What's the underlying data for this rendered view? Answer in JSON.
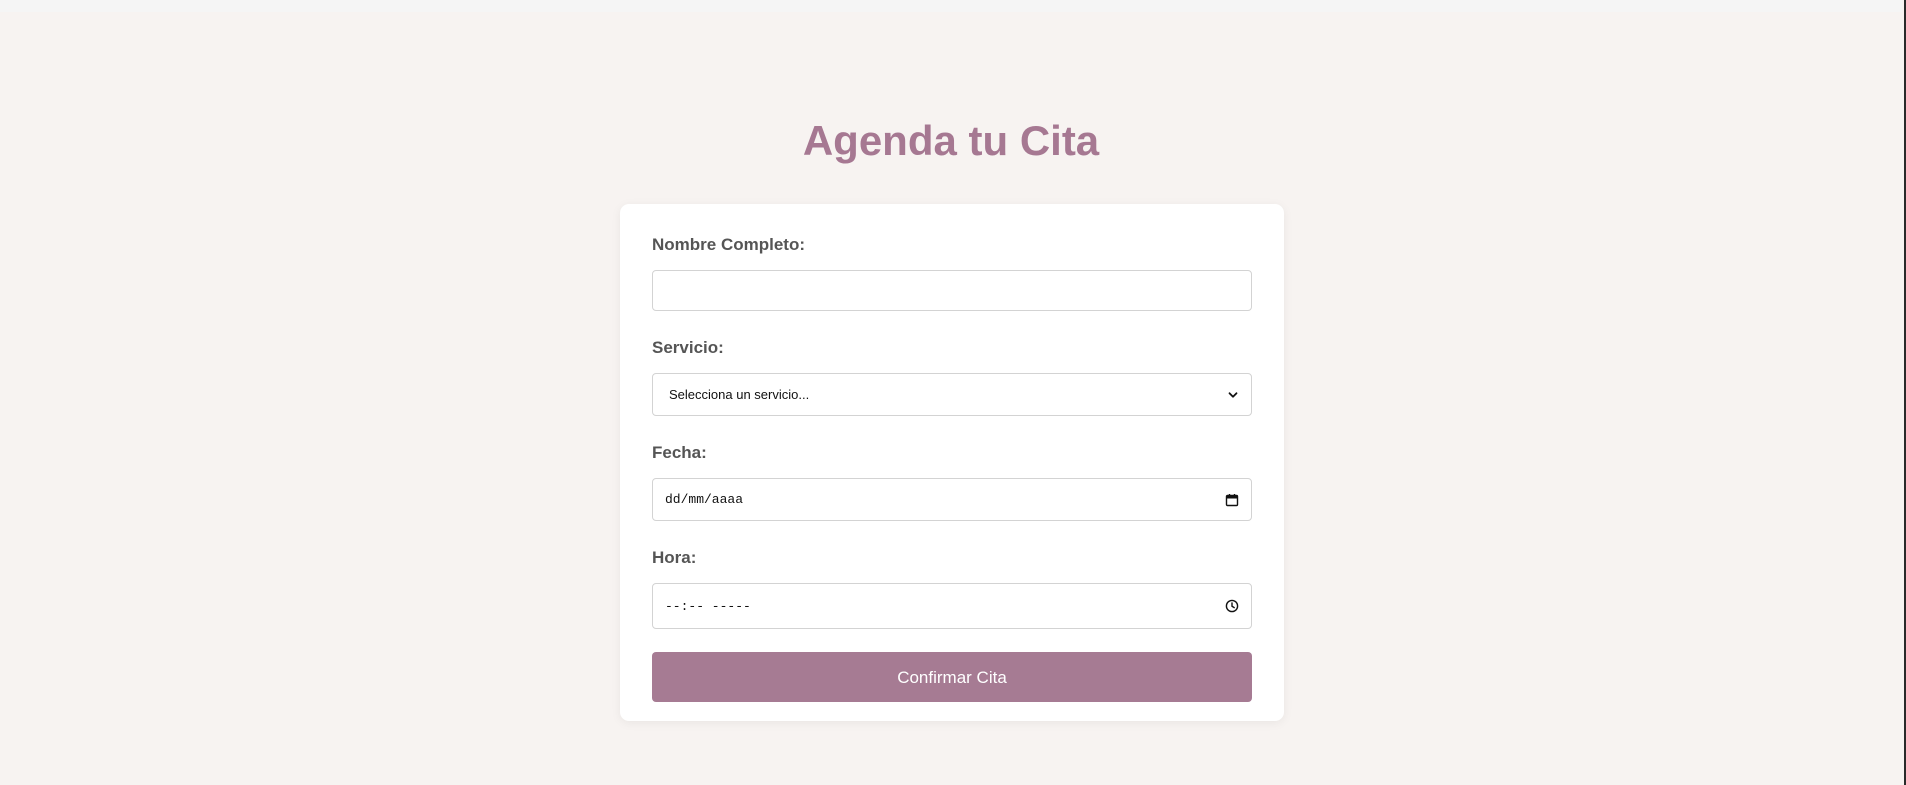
{
  "page": {
    "title": "Agenda tu Cita"
  },
  "form": {
    "name_label": "Nombre Completo:",
    "name_value": "",
    "service_label": "Servicio:",
    "service_selected": "Selecciona un servicio...",
    "date_label": "Fecha:",
    "date_placeholder": "dd/mm/aaaa",
    "time_label": "Hora:",
    "time_placeholder": "--:-- -----",
    "submit_label": "Confirmar Cita"
  },
  "icons": {
    "select": "chevron-down-icon",
    "date": "calendar-icon",
    "time": "clock-icon"
  },
  "colors": {
    "accent": "#a67b93",
    "title": "#a67892",
    "background": "#f7f3f1",
    "card": "#ffffff",
    "label": "#555555"
  }
}
